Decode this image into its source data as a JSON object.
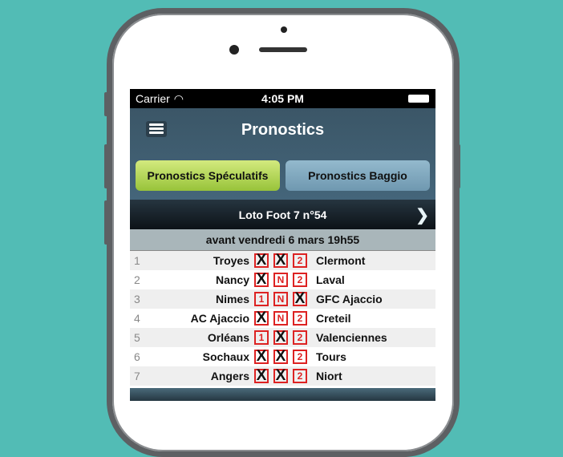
{
  "status": {
    "carrier": "Carrier",
    "time": "4:05 PM"
  },
  "header": {
    "title": "Pronostics"
  },
  "tabs": [
    {
      "label": "Pronostics Spéculatifs",
      "active": true
    },
    {
      "label": "Pronostics Baggio",
      "active": false
    }
  ],
  "grid": {
    "title": "Loto Foot 7 n°54",
    "deadline": "avant vendredi 6 mars 19h55"
  },
  "matches": [
    {
      "n": "1",
      "home": "Troyes",
      "picks": [
        "X",
        "X",
        "2"
      ],
      "away": "Clermont"
    },
    {
      "n": "2",
      "home": "Nancy",
      "picks": [
        "X",
        "N",
        "2"
      ],
      "away": "Laval"
    },
    {
      "n": "3",
      "home": "Nimes",
      "picks": [
        "1",
        "N",
        "X"
      ],
      "away": "GFC Ajaccio"
    },
    {
      "n": "4",
      "home": "AC Ajaccio",
      "picks": [
        "X",
        "N",
        "2"
      ],
      "away": "Creteil"
    },
    {
      "n": "5",
      "home": "Orléans",
      "picks": [
        "1",
        "X",
        "2"
      ],
      "away": "Valenciennes"
    },
    {
      "n": "6",
      "home": "Sochaux",
      "picks": [
        "X",
        "X",
        "2"
      ],
      "away": "Tours"
    },
    {
      "n": "7",
      "home": "Angers",
      "picks": [
        "X",
        "X",
        "2"
      ],
      "away": "Niort"
    }
  ],
  "colors": {
    "background": "#52bcb5",
    "active_tab": "#b5d85c",
    "inactive_tab": "#82a9bf",
    "box_red": "#dd2222"
  }
}
